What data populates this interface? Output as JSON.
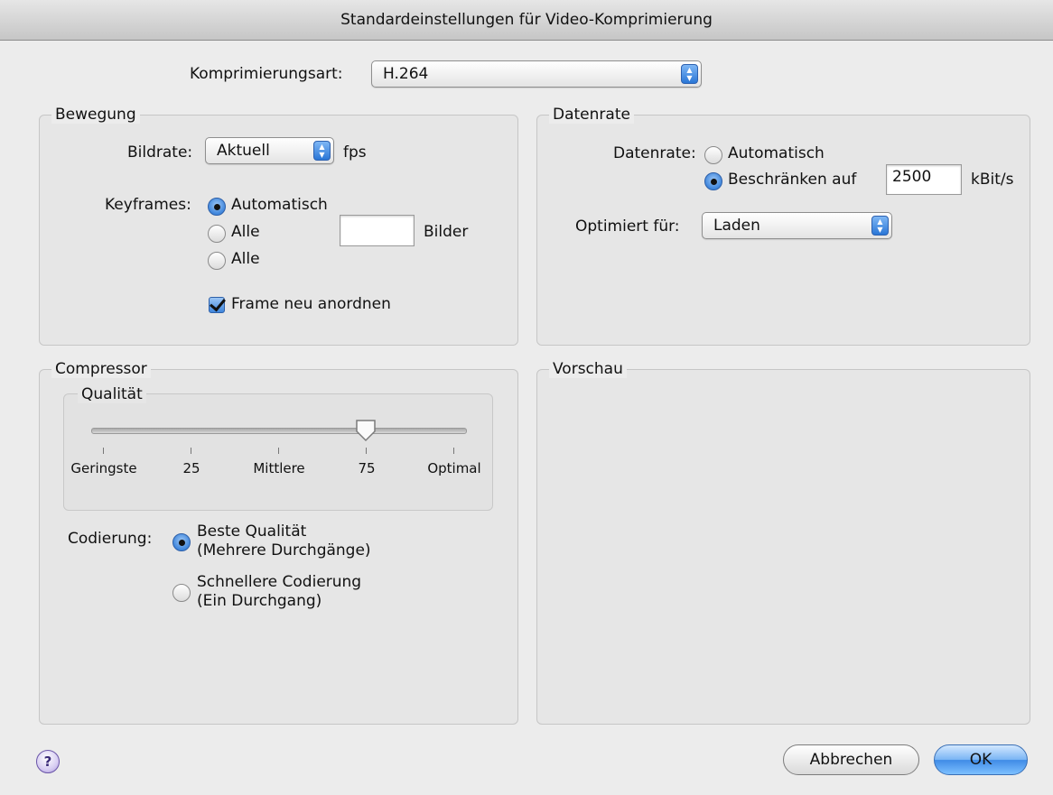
{
  "window": {
    "title": "Standardeinstellungen für Video-Komprimierung"
  },
  "compression": {
    "label": "Komprimierungsart:",
    "value": "H.264"
  },
  "motion": {
    "title": "Bewegung",
    "framerate_label": "Bildrate:",
    "framerate_value": "Aktuell",
    "framerate_unit": "fps",
    "keyframes_label": "Keyframes:",
    "keyframe_options": [
      "Automatisch",
      "Alle",
      "Alle"
    ],
    "keyframe_selected": 0,
    "keyframe_frames_value": "",
    "keyframe_frames_unit": "Bilder",
    "reorder_label": "Frame neu anordnen",
    "reorder_checked": true
  },
  "datarate": {
    "title": "Datenrate",
    "label": "Datenrate:",
    "options": [
      "Automatisch",
      "Beschränken auf"
    ],
    "selected": 1,
    "limit_value": "2500",
    "limit_unit": "kBit/s",
    "optimize_label": "Optimiert für:",
    "optimize_value": "Laden"
  },
  "compressor": {
    "title": "Compressor",
    "quality_title": "Qualität",
    "quality_ticks": [
      "Geringste",
      "25",
      "Mittlere",
      "75",
      "Optimal"
    ],
    "quality_value": 75,
    "encoding_label": "Codierung:",
    "encoding_options": [
      {
        "line1": "Beste Qualität",
        "line2": "(Mehrere Durchgänge)"
      },
      {
        "line1": "Schnellere Codierung",
        "line2": "(Ein Durchgang)"
      }
    ],
    "encoding_selected": 0
  },
  "preview": {
    "title": "Vorschau"
  },
  "buttons": {
    "help": "?",
    "cancel": "Abbrechen",
    "ok": "OK"
  },
  "colors": {
    "accent": "#3f86dc",
    "window_bg": "#ececec"
  }
}
